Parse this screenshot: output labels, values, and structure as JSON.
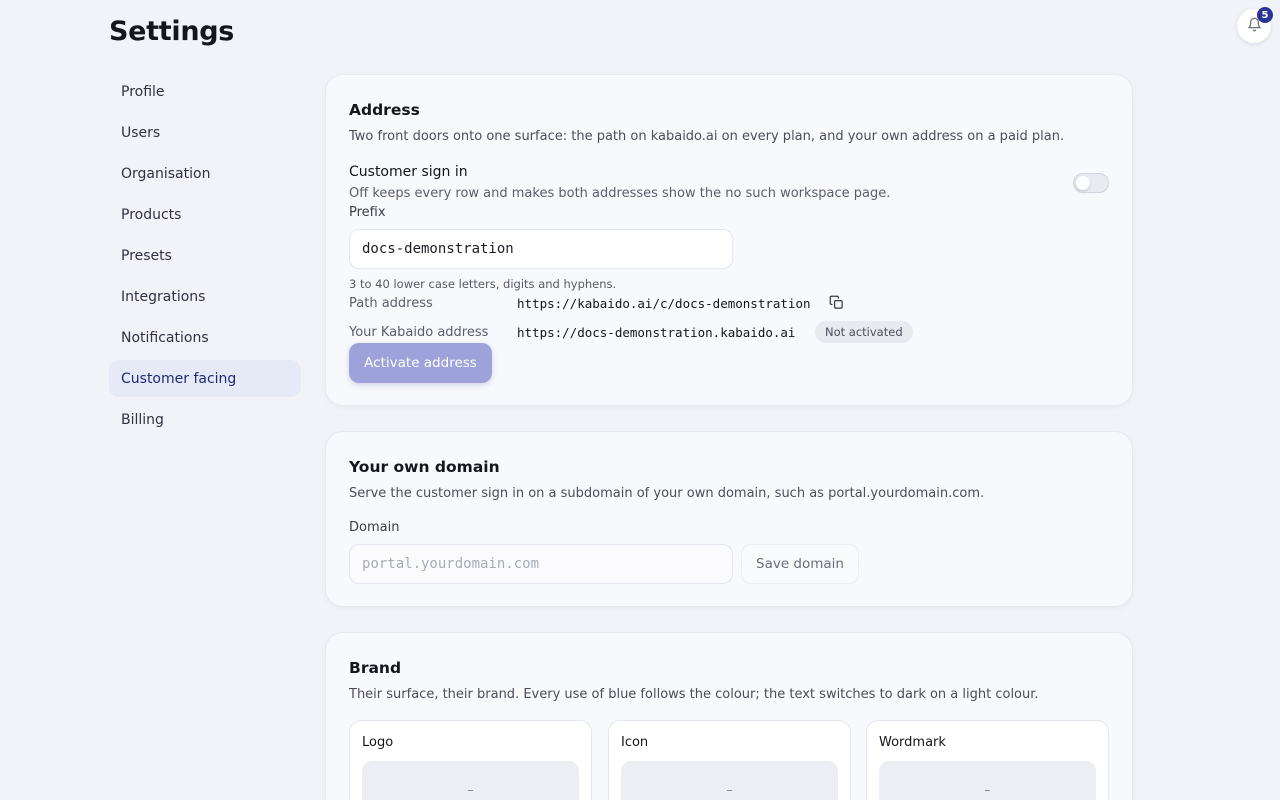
{
  "page": {
    "title": "Settings"
  },
  "notifications": {
    "count": "5"
  },
  "sidebar": {
    "items": [
      {
        "label": "Profile",
        "active": false
      },
      {
        "label": "Users",
        "active": false
      },
      {
        "label": "Organisation",
        "active": false
      },
      {
        "label": "Products",
        "active": false
      },
      {
        "label": "Presets",
        "active": false
      },
      {
        "label": "Integrations",
        "active": false
      },
      {
        "label": "Notifications",
        "active": false
      },
      {
        "label": "Customer facing",
        "active": true
      },
      {
        "label": "Billing",
        "active": false
      }
    ]
  },
  "address": {
    "title": "Address",
    "description": "Two front doors onto one surface: the path on kabaido.ai on every plan, and your own address on a paid plan.",
    "sign_in_label": "Customer sign in",
    "sign_in_description": "Off keeps every row and makes both addresses show the no such workspace page.",
    "sign_in_enabled": false,
    "prefix_label": "Prefix",
    "prefix_value": "docs-demonstration",
    "prefix_hint": "3 to 40 lower case letters, digits and hyphens.",
    "path_label": "Path address",
    "path_value": "https://kabaido.ai/c/docs-demonstration",
    "kabaido_label": "Your Kabaido address",
    "kabaido_value": "https://docs-demonstration.kabaido.ai",
    "status_badge": "Not activated",
    "activate_button": "Activate address"
  },
  "domain": {
    "title": "Your own domain",
    "description": "Serve the customer sign in on a subdomain of your own domain, such as portal.yourdomain.com.",
    "field_label": "Domain",
    "placeholder": "portal.yourdomain.com",
    "save_button": "Save domain"
  },
  "brand": {
    "title": "Brand",
    "description": "Their surface, their brand. Every use of blue follows the colour; the text switches to dark on a light colour.",
    "boxes": [
      {
        "title": "Logo",
        "placeholder": "–"
      },
      {
        "title": "Icon",
        "placeholder": "–"
      },
      {
        "title": "Wordmark",
        "placeholder": "–"
      }
    ]
  },
  "colors": {
    "accent": "#2c3597",
    "primary_button": "#9ea2da",
    "active_nav_bg": "#e6e9f6",
    "page_bg": "#f1f3f8"
  },
  "icons": {
    "notifications": "bell-icon",
    "copy": "copy-icon"
  }
}
